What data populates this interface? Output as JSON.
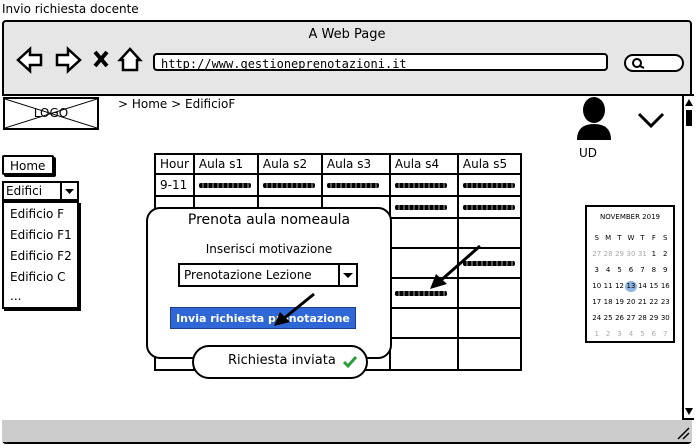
{
  "page_title": "Invio richiesta docente",
  "window": {
    "title": "A Web Page",
    "url": "http://www.gestioneprenotazioni.it"
  },
  "header": {
    "logo": "LOGO",
    "breadcrumb": "> Home > EdificioF",
    "user": "UD"
  },
  "sidebar": {
    "home": "Home",
    "combo_value": "Edifici",
    "items": [
      "Edificio F",
      "Edificio F1",
      "Edificio F2",
      "Edificio C",
      "..."
    ]
  },
  "table": {
    "headers": [
      "Hour",
      "Aula s1",
      "Aula s2",
      "Aula s3",
      "Aula s4",
      "Aula s5"
    ],
    "first_time": "9-11"
  },
  "dialog": {
    "title": "Prenota aula nomeaula",
    "label": "Inserisci motivazione",
    "select_value": "Prenotazione Lezione",
    "button": "Invia richiesta prenotazione"
  },
  "toast": {
    "text": "Richiesta inviata"
  },
  "calendar": {
    "title": "NOVEMBER 2019",
    "weekdays": [
      "S",
      "M",
      "T",
      "W",
      "T",
      "F",
      "S"
    ],
    "days": [
      "27",
      "28",
      "29",
      "30",
      "31",
      "1",
      "2",
      "3",
      "4",
      "5",
      "6",
      "7",
      "8",
      "9",
      "10",
      "11",
      "12",
      "13",
      "14",
      "15",
      "16",
      "17",
      "18",
      "19",
      "20",
      "21",
      "22",
      "23",
      "24",
      "25",
      "26",
      "27",
      "28",
      "29",
      "30",
      "1",
      "2",
      "3",
      "4",
      "5",
      "6",
      "7"
    ],
    "selected": "13"
  }
}
